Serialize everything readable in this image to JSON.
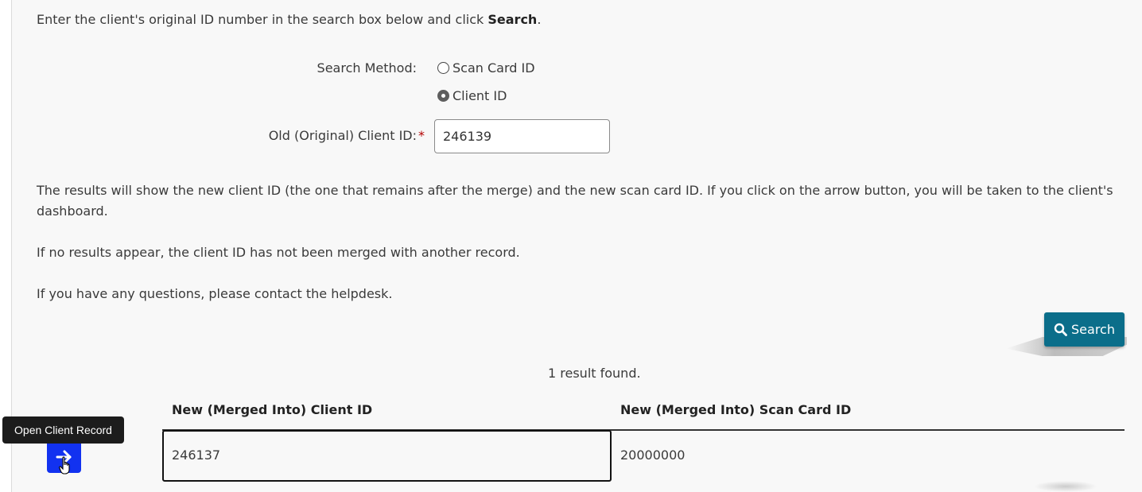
{
  "intro": {
    "text_before": "Enter the client's original ID number in the search box below and click ",
    "bold": "Search",
    "text_after": "."
  },
  "search_method": {
    "label": "Search Method:",
    "options": [
      {
        "label": "Scan Card ID",
        "checked": false
      },
      {
        "label": "Client ID",
        "checked": true
      }
    ]
  },
  "old_client_id": {
    "label": "Old (Original) Client ID:",
    "required_mark": "*",
    "value": "246139"
  },
  "info": {
    "p1": "The results will show the new client ID (the one that remains after the merge) and the new scan card ID. If you click on the arrow button, you will be taken to the client's dashboard.",
    "p2": "If no results appear, the client ID has not been merged with another record.",
    "p3": "If you have any questions, please contact the helpdesk."
  },
  "search_button": {
    "label": "Search",
    "icon": "search-icon",
    "color": "#0b6e8a"
  },
  "results": {
    "summary": "1 result found.",
    "columns": [
      "New (Merged Into) Client ID",
      "New (Merged Into) Scan Card ID"
    ],
    "rows": [
      {
        "client_id": "246137",
        "scan_card_id": "20000000"
      }
    ],
    "open_button_color": "#1232f0",
    "tooltip": "Open Client Record"
  }
}
